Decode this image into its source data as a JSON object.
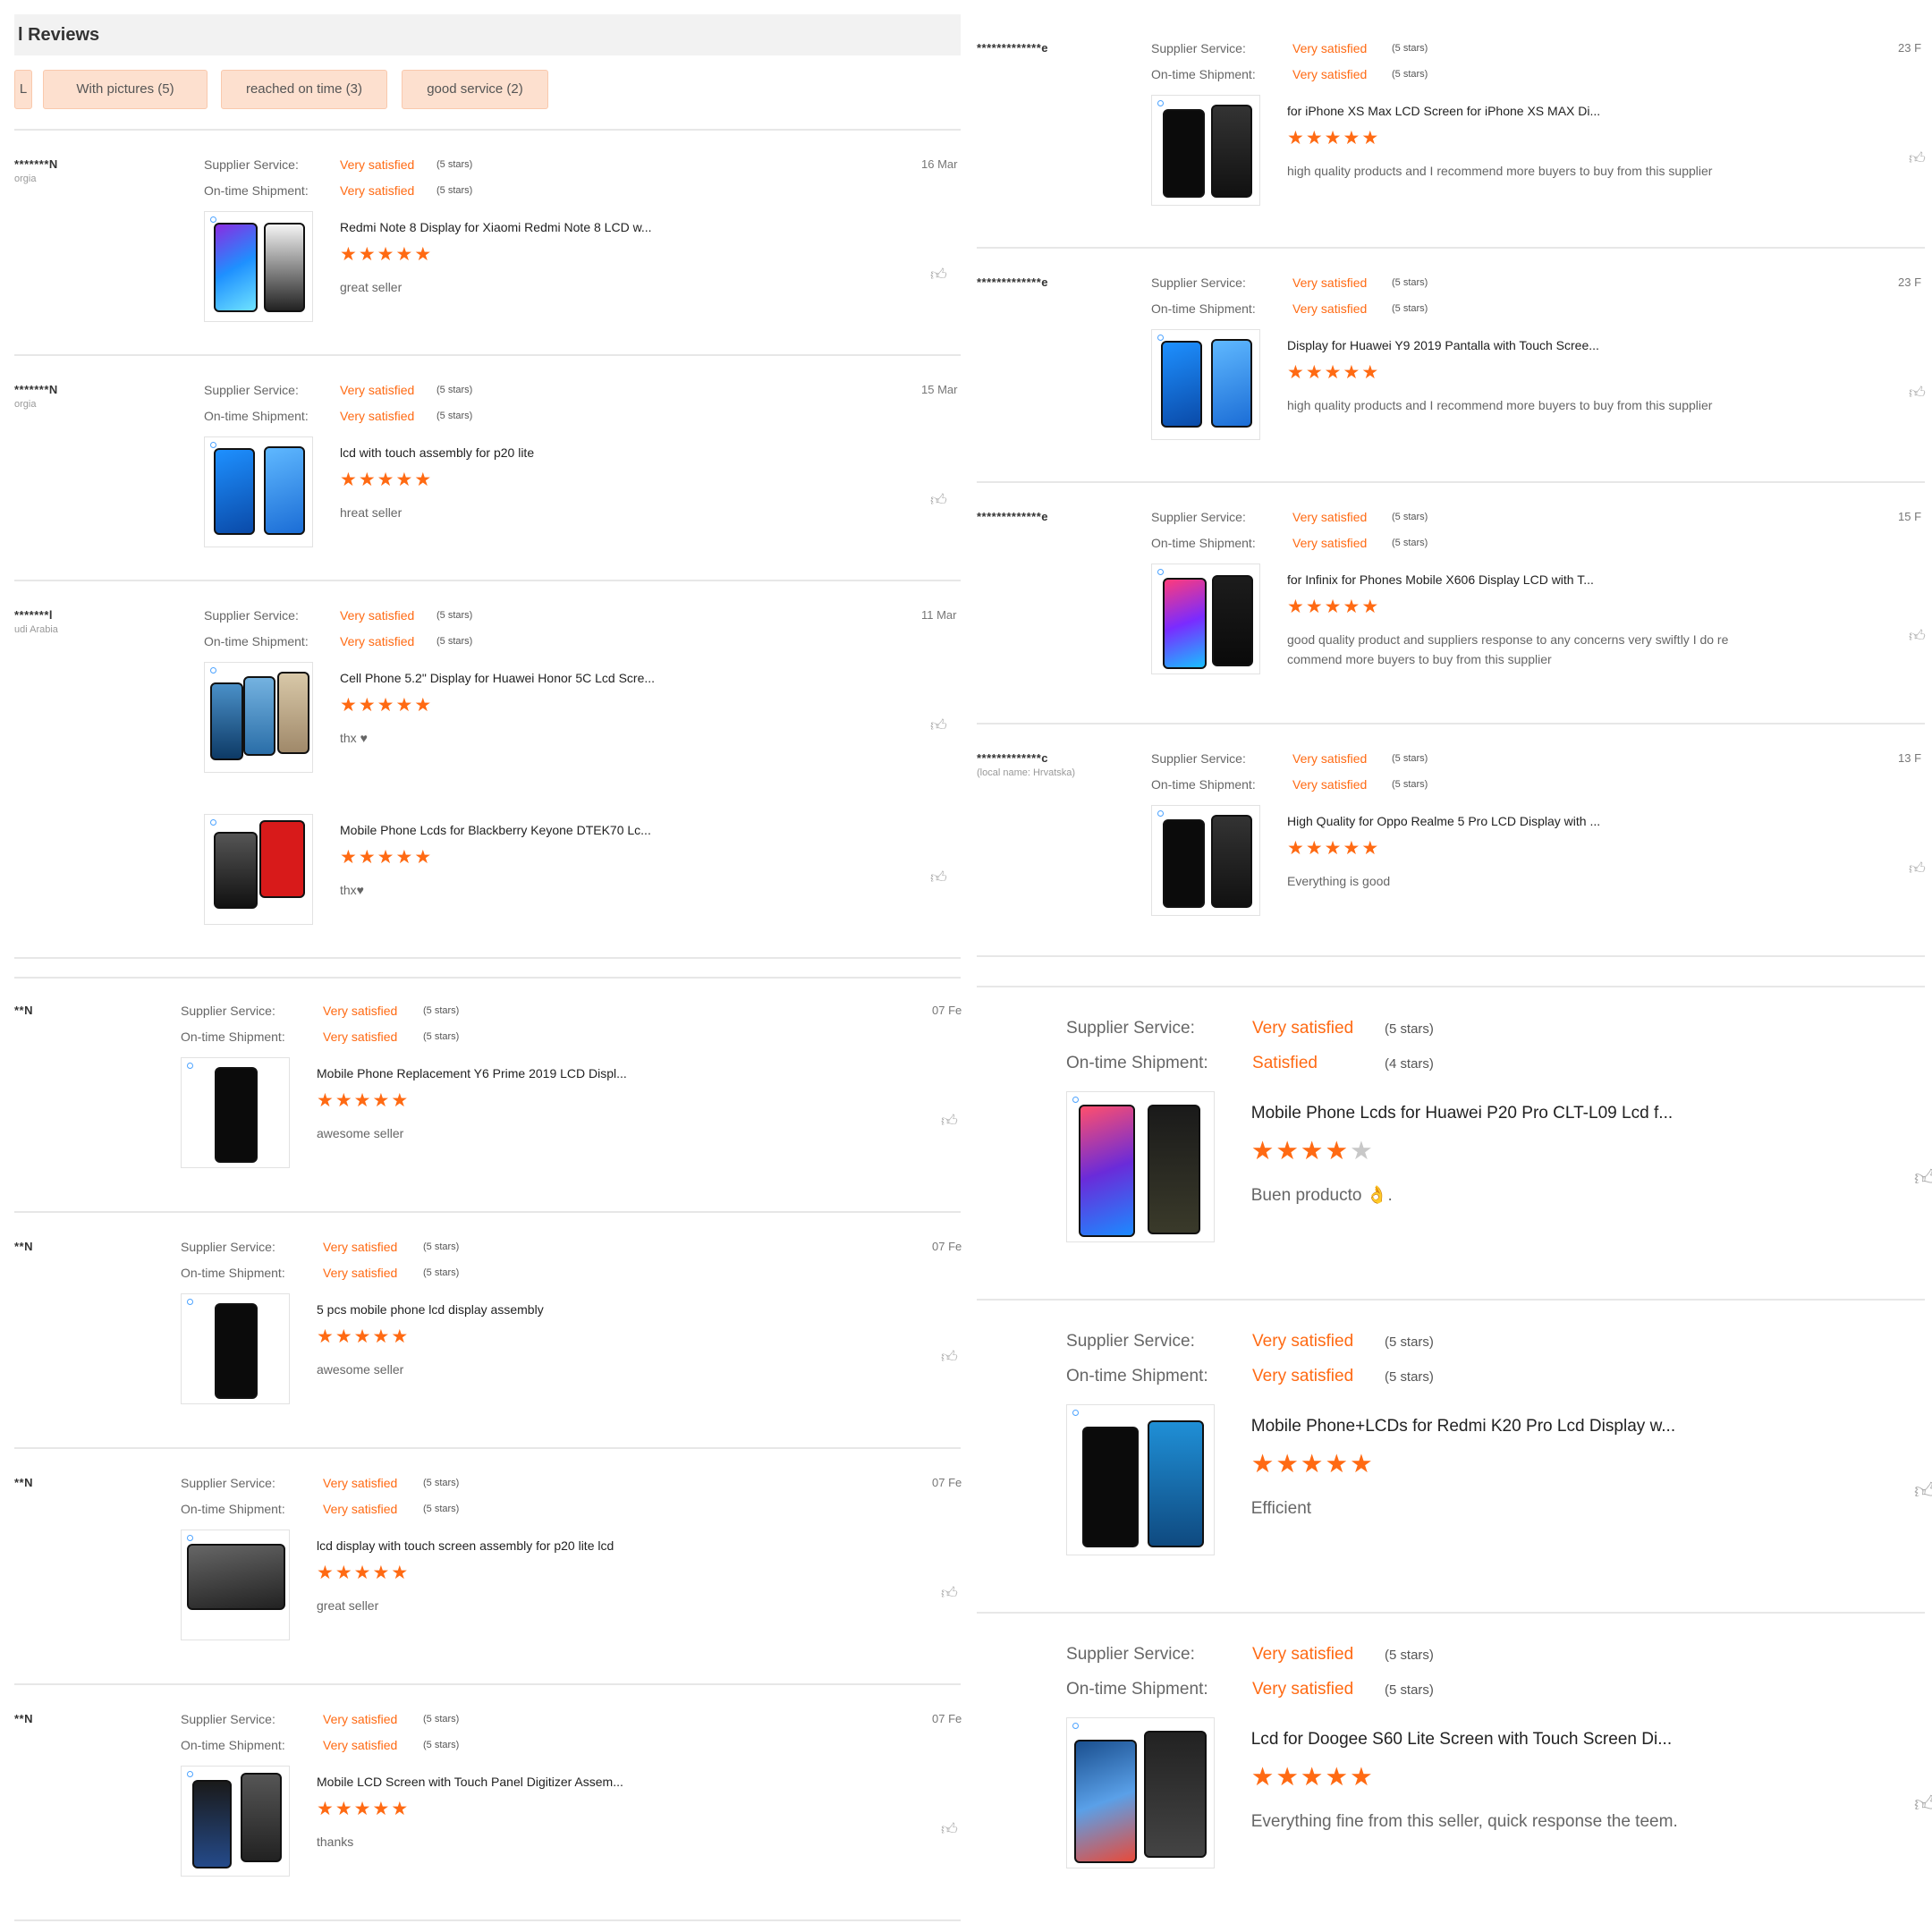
{
  "header": {
    "title": "l Reviews"
  },
  "filters": [
    {
      "label": "L"
    },
    {
      "label": "With pictures (5)"
    },
    {
      "label": "reached on time (3)"
    },
    {
      "label": "good service (2)"
    }
  ],
  "labels": {
    "supplier_service": "Supplier Service:",
    "ontime_shipment": "On-time Shipment:",
    "like_icon": "thumbs-up-icon"
  },
  "colors": {
    "accent": "#ff6a13",
    "filter_bg": "#fde0cf",
    "header_bg": "#f2f2f2"
  },
  "left_reviews": [
    {
      "user": "*******N",
      "country": "orgia",
      "date": "16 Mar",
      "supplier_rating": "Very satisfied",
      "supplier_stars": "(5 stars)",
      "shipment_rating": "Very satisfied",
      "shipment_stars": "(5 stars)",
      "products": [
        {
          "title": "Redmi Note 8 Display for Xiaomi Redmi Note 8 LCD w...",
          "rating": 5,
          "comment": "great seller"
        }
      ]
    },
    {
      "user": "*******N",
      "country": "orgia",
      "date": "15 Mar",
      "supplier_rating": "Very satisfied",
      "supplier_stars": "(5 stars)",
      "shipment_rating": "Very satisfied",
      "shipment_stars": "(5 stars)",
      "products": [
        {
          "title": "lcd with touch assembly for p20 lite",
          "rating": 5,
          "comment": "hreat seller"
        }
      ]
    },
    {
      "user": "*******l",
      "country": "udi Arabia",
      "date": "11 Mar",
      "supplier_rating": "Very satisfied",
      "supplier_stars": "(5 stars)",
      "shipment_rating": "Very satisfied",
      "shipment_stars": "(5 stars)",
      "products": [
        {
          "title": "Cell Phone 5.2\" Display for Huawei Honor 5C Lcd Scre...",
          "rating": 5,
          "comment": "thx ♥"
        },
        {
          "title": "Mobile Phone Lcds for Blackberry Keyone DTEK70 Lc...",
          "rating": 5,
          "comment": "thx♥"
        }
      ]
    },
    {
      "user": "**N",
      "country": "",
      "date": "07 Fe",
      "supplier_rating": "Very satisfied",
      "supplier_stars": "(5 stars)",
      "shipment_rating": "Very satisfied",
      "shipment_stars": "(5 stars)",
      "products": [
        {
          "title": "Mobile Phone Replacement Y6 Prime 2019 LCD Displ...",
          "rating": 5,
          "comment": "awesome seller"
        }
      ]
    },
    {
      "user": "**N",
      "country": "",
      "date": "07 Fe",
      "supplier_rating": "Very satisfied",
      "supplier_stars": "(5 stars)",
      "shipment_rating": "Very satisfied",
      "shipment_stars": "(5 stars)",
      "products": [
        {
          "title": "5 pcs mobile phone lcd display assembly",
          "rating": 5,
          "comment": "awesome seller"
        }
      ]
    },
    {
      "user": "**N",
      "country": "",
      "date": "07 Fe",
      "supplier_rating": "Very satisfied",
      "supplier_stars": "(5 stars)",
      "shipment_rating": "Very satisfied",
      "shipment_stars": "(5 stars)",
      "products": [
        {
          "title": "lcd display with touch screen assembly for p20 lite lcd",
          "rating": 5,
          "comment": "great seller"
        }
      ]
    },
    {
      "user": "**N",
      "country": "",
      "date": "07 Fe",
      "supplier_rating": "Very satisfied",
      "supplier_stars": "(5 stars)",
      "shipment_rating": "Very satisfied",
      "shipment_stars": "(5 stars)",
      "products": [
        {
          "title": "Mobile LCD Screen with Touch Panel Digitizer Assem...",
          "rating": 5,
          "comment": "thanks"
        }
      ]
    }
  ],
  "right_reviews": [
    {
      "user": "*************e",
      "country": "",
      "date": "23 F",
      "supplier_rating": "Very satisfied",
      "supplier_stars": "(5 stars)",
      "shipment_rating": "Very satisfied",
      "shipment_stars": "(5 stars)",
      "products": [
        {
          "title": "for iPhone XS Max LCD Screen for iPhone XS MAX Di...",
          "rating": 5,
          "comment": "high quality products and I recommend more buyers to buy from this supplier"
        }
      ]
    },
    {
      "user": "*************e",
      "country": "",
      "date": "23 F",
      "supplier_rating": "Very satisfied",
      "supplier_stars": "(5 stars)",
      "shipment_rating": "Very satisfied",
      "shipment_stars": "(5 stars)",
      "products": [
        {
          "title": "Display for Huawei Y9 2019 Pantalla with Touch Scree...",
          "rating": 5,
          "comment": "high quality products and I recommend more buyers to buy from this supplier"
        }
      ]
    },
    {
      "user": "*************e",
      "country": "",
      "date": "15 F",
      "supplier_rating": "Very satisfied",
      "supplier_stars": "(5 stars)",
      "shipment_rating": "Very satisfied",
      "shipment_stars": "(5 stars)",
      "products": [
        {
          "title": "for Infinix for Phones Mobile X606 Display LCD with T...",
          "rating": 5,
          "comment": "good quality product and  suppliers response to any concerns very swiftly   I do re",
          "comment2": "commend more buyers to buy from this supplier"
        }
      ]
    },
    {
      "user": "*************c",
      "country": "(local name: Hrvatska)",
      "date": "13 F",
      "supplier_rating": "Very satisfied",
      "supplier_stars": "(5 stars)",
      "shipment_rating": "Very satisfied",
      "shipment_stars": "(5 stars)",
      "products": [
        {
          "title": "High Quality for Oppo Realme 5 Pro LCD Display with ...",
          "rating": 5,
          "comment": "Everything is good"
        }
      ]
    },
    {
      "user": "",
      "country": "",
      "date": "",
      "supplier_rating": "Very satisfied",
      "supplier_stars": "(5 stars)",
      "shipment_rating": "Satisfied",
      "shipment_stars": "(4 stars)",
      "products": [
        {
          "title": "Mobile Phone Lcds for Huawei P20 Pro CLT-L09 Lcd f...",
          "rating": 4,
          "comment": "Buen producto 👌."
        }
      ]
    },
    {
      "user": "",
      "country": "",
      "date": "",
      "supplier_rating": "Very satisfied",
      "supplier_stars": "(5 stars)",
      "shipment_rating": "Very satisfied",
      "shipment_stars": "(5 stars)",
      "products": [
        {
          "title": "Mobile Phone+LCDs for Redmi K20 Pro Lcd Display w...",
          "rating": 5,
          "comment": "Efficient"
        }
      ]
    },
    {
      "user": "",
      "country": "",
      "date": "",
      "supplier_rating": "Very satisfied",
      "supplier_stars": "(5 stars)",
      "shipment_rating": "Very satisfied",
      "shipment_stars": "(5 stars)",
      "products": [
        {
          "title": "Lcd for Doogee S60 Lite Screen with Touch Screen Di...",
          "rating": 5,
          "comment": "Everything fine from this seller, quick response the teem."
        }
      ]
    }
  ]
}
